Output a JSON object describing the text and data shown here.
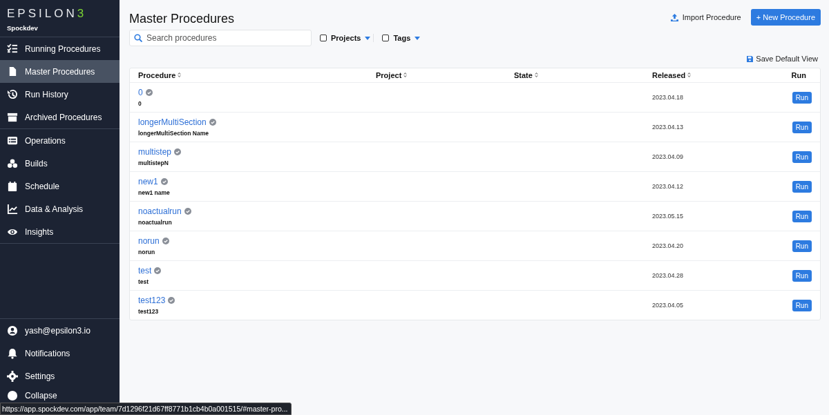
{
  "sidebar": {
    "logo": "EPSILON3",
    "workspace": "Spockdev",
    "groups": [
      [
        {
          "label": "Running Procedures",
          "selected": false
        },
        {
          "label": "Master Procedures",
          "selected": true
        },
        {
          "label": "Run History",
          "selected": false
        },
        {
          "label": "Archived Procedures",
          "selected": false
        }
      ],
      [
        {
          "label": "Operations",
          "selected": false
        },
        {
          "label": "Builds",
          "selected": false
        },
        {
          "label": "Schedule",
          "selected": false
        },
        {
          "label": "Data & Analysis",
          "selected": false
        },
        {
          "label": "Insights",
          "selected": false
        }
      ]
    ],
    "bottom": [
      {
        "label": "yash@epsilon3.io",
        "selected": false
      },
      {
        "label": "Notifications",
        "selected": false
      },
      {
        "label": "Settings",
        "selected": false
      },
      {
        "label": "Collapse",
        "selected": false
      }
    ]
  },
  "header": {
    "title": "Master Procedures",
    "import_button": "Import Procedure",
    "new_button": "+ New Procedure"
  },
  "filters": {
    "search": {
      "placeholder": "Search procedures"
    },
    "projects": {
      "label": "Projects",
      "checked": false
    },
    "tags": {
      "label": "Tags",
      "checked": false
    },
    "save_view": "Save Default View"
  },
  "table": {
    "columns": [
      {
        "label": "Procedure",
        "sortable": true
      },
      {
        "label": "Project",
        "sortable": true
      },
      {
        "label": "State",
        "sortable": true
      },
      {
        "label": "Released",
        "sortable": true
      },
      {
        "label": "Run",
        "sortable": false
      }
    ],
    "rows": [
      {
        "name": "0",
        "subtitle": "0",
        "released": "2023.04.18",
        "run": "Run"
      },
      {
        "name": "longerMultiSection",
        "subtitle": "longerMultiSection Name",
        "released": "2023.04.13",
        "run": "Run"
      },
      {
        "name": "multistep",
        "subtitle": "multistepN",
        "released": "2023.04.09",
        "run": "Run"
      },
      {
        "name": "new1",
        "subtitle": "new1 name",
        "released": "2023.04.12",
        "run": "Run"
      },
      {
        "name": "noactualrun",
        "subtitle": "noactualrun",
        "released": "2023.05.15",
        "run": "Run"
      },
      {
        "name": "norun",
        "subtitle": "norun",
        "released": "2023.04.20",
        "run": "Run"
      },
      {
        "name": "test",
        "subtitle": "test",
        "released": "2023.04.28",
        "run": "Run"
      },
      {
        "name": "test123",
        "subtitle": "test123",
        "released": "2023.04.05",
        "run": "Run"
      }
    ]
  },
  "status_url": "https://app.spockdev.com/app/team/7d1296f21d67ff8771b1cb4b0a001515/#master-pro..."
}
